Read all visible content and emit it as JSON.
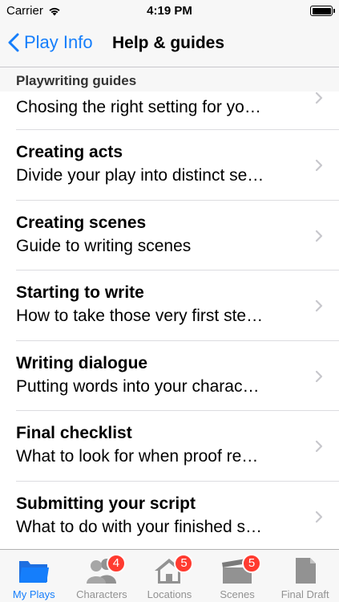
{
  "status_bar": {
    "carrier": "Carrier",
    "time": "4:19 PM"
  },
  "nav": {
    "back_label": "Play Info",
    "title": "Help & guides"
  },
  "section": {
    "header": "Playwriting guides"
  },
  "rows": [
    {
      "title": "",
      "subtitle": "Chosing the right setting for yo…"
    },
    {
      "title": "Creating acts",
      "subtitle": "Divide your play into distinct se…"
    },
    {
      "title": "Creating scenes",
      "subtitle": "Guide to writing scenes"
    },
    {
      "title": "Starting to write",
      "subtitle": "How to take those very first ste…"
    },
    {
      "title": "Writing dialogue",
      "subtitle": "Putting words into your charac…"
    },
    {
      "title": "Final checklist",
      "subtitle": "What to look for when proof re…"
    },
    {
      "title": "Submitting your script",
      "subtitle": "What to do with your finished s…"
    }
  ],
  "tabs": [
    {
      "label": "My Plays",
      "icon": "folder-icon",
      "badge": ""
    },
    {
      "label": "Characters",
      "icon": "people-icon",
      "badge": "4"
    },
    {
      "label": "Locations",
      "icon": "house-icon",
      "badge": "5"
    },
    {
      "label": "Scenes",
      "icon": "clapperboard-icon",
      "badge": "5"
    },
    {
      "label": "Final Draft",
      "icon": "document-icon",
      "badge": ""
    }
  ],
  "colors": {
    "accent": "#157efb",
    "badge": "#ff3b30",
    "inactive": "#929292"
  }
}
